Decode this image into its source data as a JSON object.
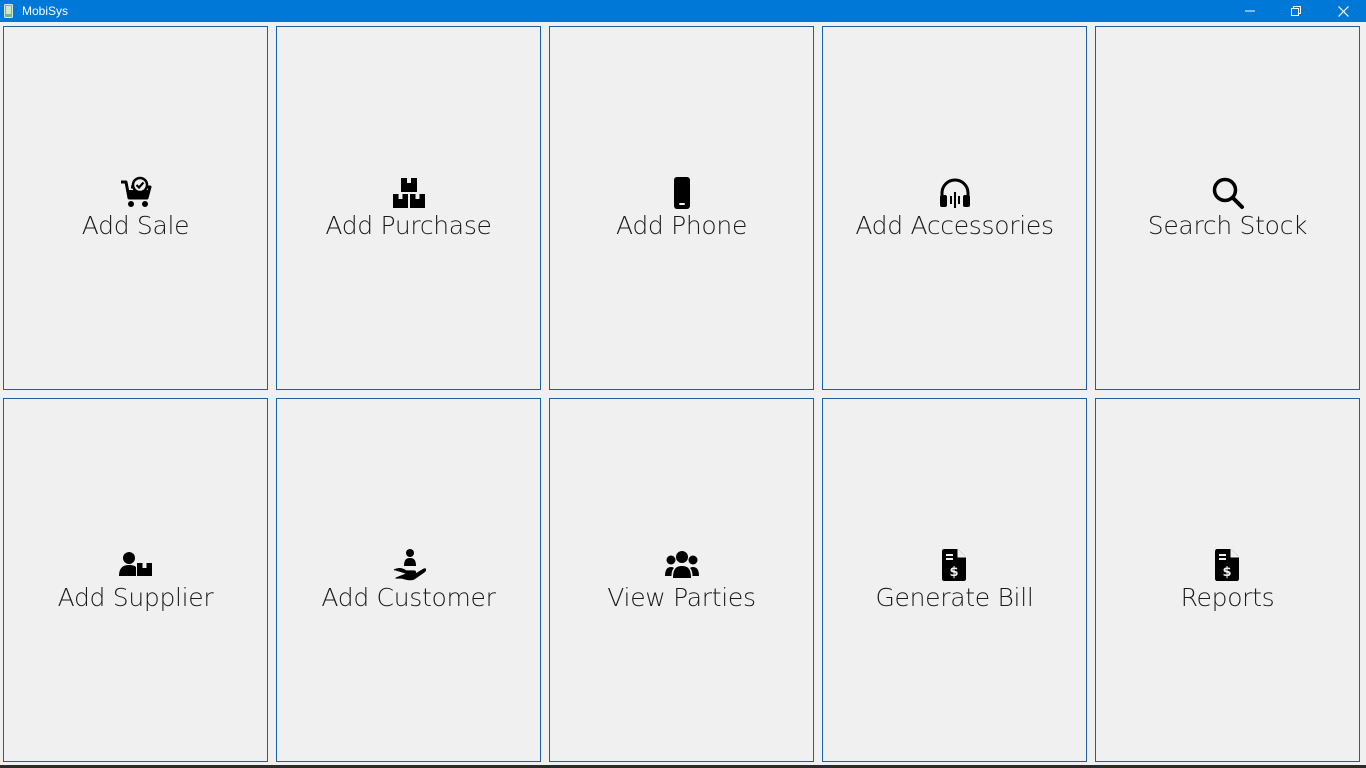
{
  "window": {
    "title": "MobiSys",
    "accent_color": "#0078d7",
    "tile_border_color": "#1b5fa8",
    "controls": {
      "minimize_icon": "minimize-icon",
      "restore_icon": "restore-icon",
      "close_icon": "close-icon"
    }
  },
  "tiles": [
    {
      "label": "Add Sale",
      "icon": "cart-check-icon"
    },
    {
      "label": "Add Purchase",
      "icon": "boxes-icon"
    },
    {
      "label": "Add Phone",
      "icon": "mobile-phone-icon"
    },
    {
      "label": "Add Accessories",
      "icon": "headphones-icon"
    },
    {
      "label": "Search Stock",
      "icon": "search-icon"
    },
    {
      "label": "Add Supplier",
      "icon": "user-box-icon"
    },
    {
      "label": "Add Customer",
      "icon": "hand-holding-user-icon"
    },
    {
      "label": "View Parties",
      "icon": "users-group-icon"
    },
    {
      "label": "Generate Bill",
      "icon": "invoice-dollar-icon"
    },
    {
      "label": "Reports",
      "icon": "invoice-dollar-icon"
    }
  ]
}
